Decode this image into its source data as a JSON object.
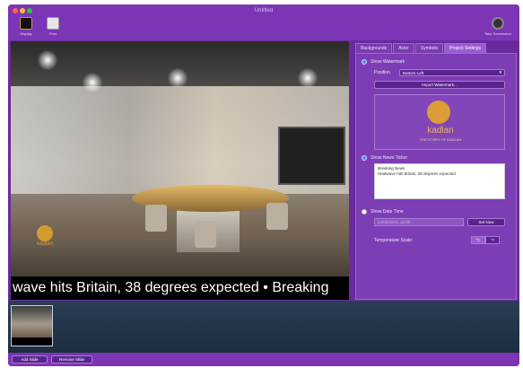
{
  "window": {
    "title": "Untitled"
  },
  "toolbar": {
    "left": [
      {
        "label": "Display",
        "icon": "display-icon"
      },
      {
        "label": "Print",
        "icon": "printer-icon"
      }
    ],
    "right": {
      "label": "Take Screenshot",
      "icon": "camera-icon"
    }
  },
  "preview": {
    "ticker_text": "wave hits Britain, 38 degrees expected • Breaking",
    "watermark_text": "kadlan"
  },
  "tabs": [
    {
      "label": "Backgrounds",
      "active": false
    },
    {
      "label": "Actor",
      "active": false
    },
    {
      "label": "Symbols",
      "active": false
    },
    {
      "label": "Project Settings",
      "active": true
    }
  ],
  "settings": {
    "show_watermark": {
      "label": "Show Watermark",
      "checked": true
    },
    "position": {
      "label": "Position",
      "value": "Bottom-Left"
    },
    "import_button": "Import Watermark...",
    "watermark_preview": {
      "name": "kadlan",
      "tagline": "THE STORY OF KADLAN"
    },
    "show_news_ticker": {
      "label": "Show News Ticker",
      "checked": true
    },
    "ticker_text_lines": [
      "Breaking News",
      "Heatwave hits Britain, 38 degrees expected"
    ],
    "show_date_time": {
      "label": "Show Date Time",
      "checked": false
    },
    "date_value": "24/06/2016, 12:00",
    "set_now_button": "Set Now",
    "temperature_scale": {
      "label": "Temperature Scale:",
      "options": [
        "°C",
        "°F"
      ],
      "selected": "°C"
    }
  },
  "bottom": {
    "add_slide": "Add Slide",
    "remove_slide": "Remove Slide"
  }
}
